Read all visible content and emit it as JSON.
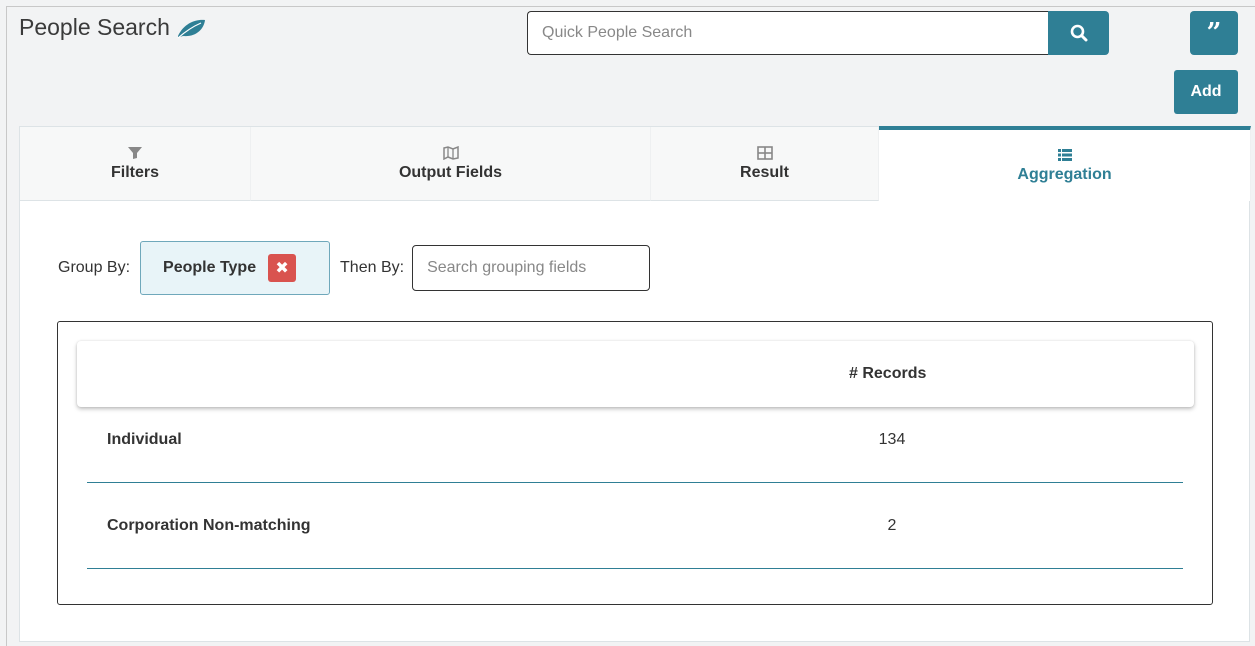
{
  "header": {
    "title": "People Search",
    "search_placeholder": "Quick People Search",
    "add_label": "Add",
    "quote_glyph": "”"
  },
  "tabs": [
    {
      "label": "Filters",
      "icon": "filter-icon",
      "active": false
    },
    {
      "label": "Output Fields",
      "icon": "map-icon",
      "active": false
    },
    {
      "label": "Result",
      "icon": "table-icon",
      "active": false
    },
    {
      "label": "Aggregation",
      "icon": "list-icon",
      "active": true
    }
  ],
  "grouping": {
    "group_by_label": "Group By:",
    "group_by_value": "People Type",
    "remove_glyph": "✖",
    "then_by_label": "Then By:",
    "then_by_placeholder": "Search grouping fields"
  },
  "aggregation": {
    "column_header": "# Records",
    "rows": [
      {
        "label": "Individual",
        "count": "134"
      },
      {
        "label": "Corporation Non-matching",
        "count": "2"
      }
    ]
  },
  "colors": {
    "accent": "#2f7f95",
    "danger": "#d9534f",
    "chip_bg": "#e8f4f8"
  }
}
